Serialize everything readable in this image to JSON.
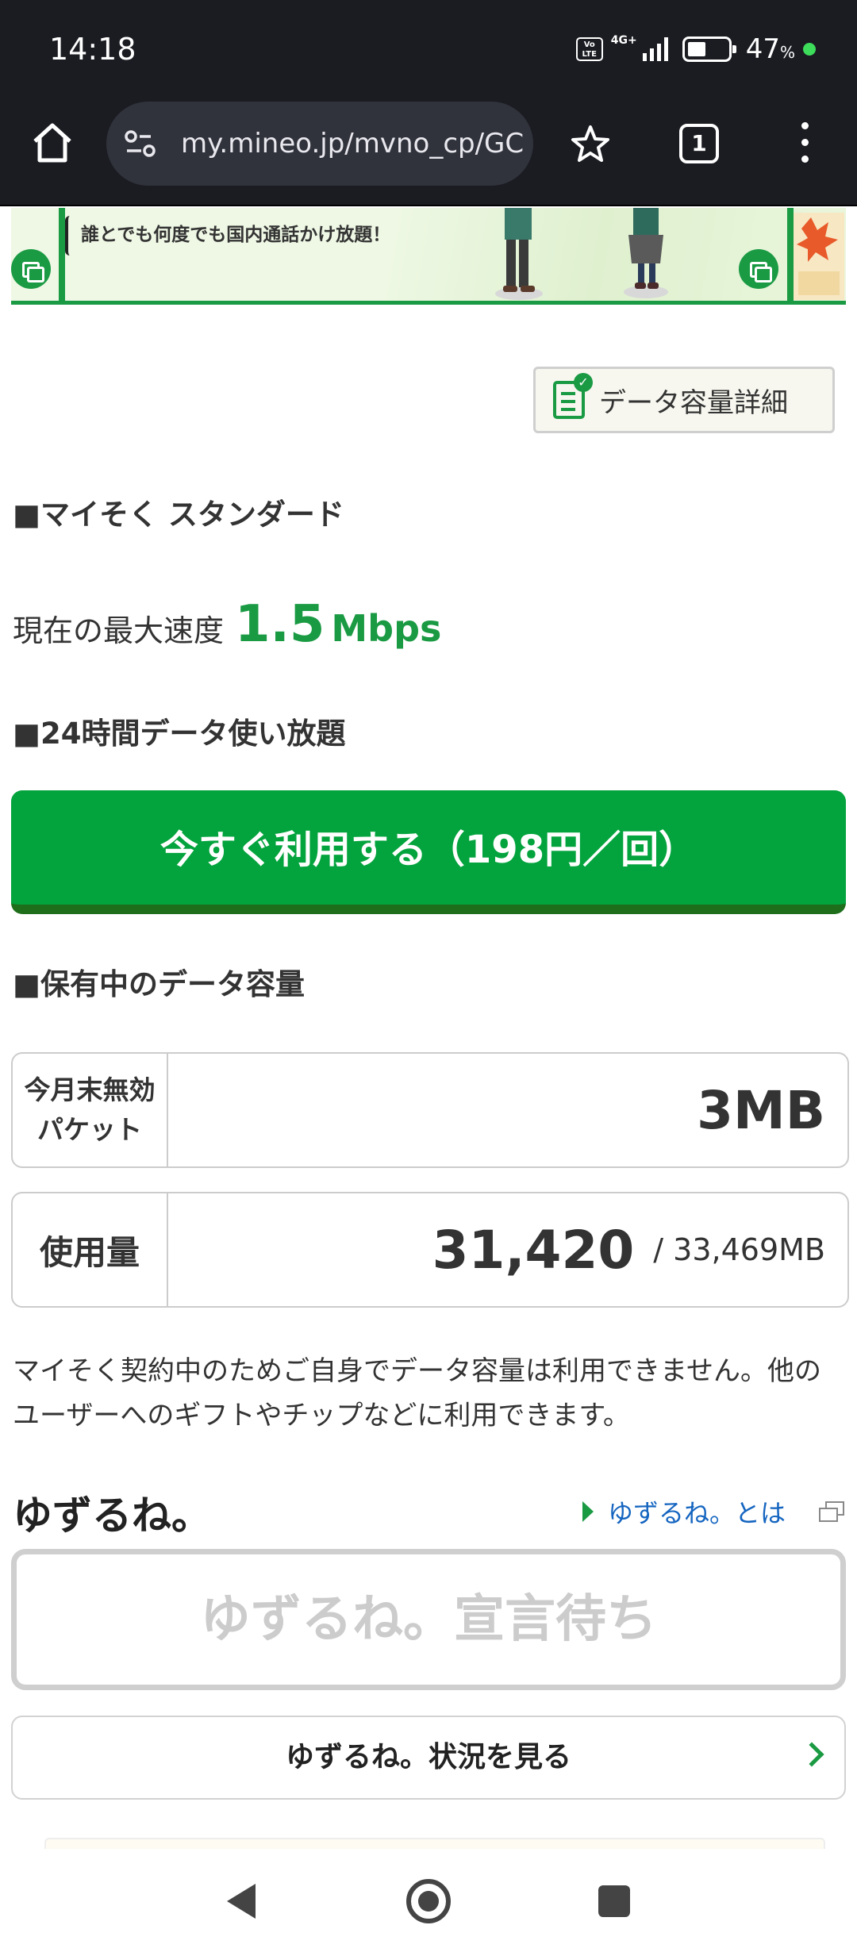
{
  "status_bar": {
    "time": "14:18",
    "volte": "Vo LTE",
    "network": "4G+",
    "battery_percent": "47",
    "battery_unit": "%"
  },
  "browser": {
    "url": "my.mineo.jp/mvno_cp/GC",
    "tab_count": "1"
  },
  "banner": {
    "text": "誰とでも何度でも国内通話かけ放題！"
  },
  "data_detail_button": {
    "label": "データ容量詳細"
  },
  "plan": {
    "title": "■マイそく スタンダード",
    "speed_label": "現在の最大速度",
    "speed_value": "1.5",
    "speed_unit": "Mbps"
  },
  "unlimited": {
    "title": "■24時間データ使い放題",
    "button_label": "今すぐ利用する（198円／回）"
  },
  "holding": {
    "title": "■保有中のデータ容量",
    "expiring_label_line1": "今月末無効",
    "expiring_label_line2": "パケット",
    "expiring_value": "3MB",
    "usage_label": "使用量",
    "usage_value": "31,420",
    "usage_total": "/ 33,469MB",
    "note": "マイそく契約中のためご自身でデータ容量は利用できません。他のユーザーへのギフトやチップなどに利用できます。"
  },
  "yuzurune": {
    "title": "ゆずるね。",
    "about_link": "ゆずるね。とは",
    "status": "ゆずるね。宣言待ち",
    "view_button": "ゆずるね。状況を見る"
  },
  "colors": {
    "brand_green": "#03a33d",
    "dark_green": "#1e6e1c",
    "link_blue": "#1565c0",
    "toolbar_bg": "#1b1c22"
  }
}
